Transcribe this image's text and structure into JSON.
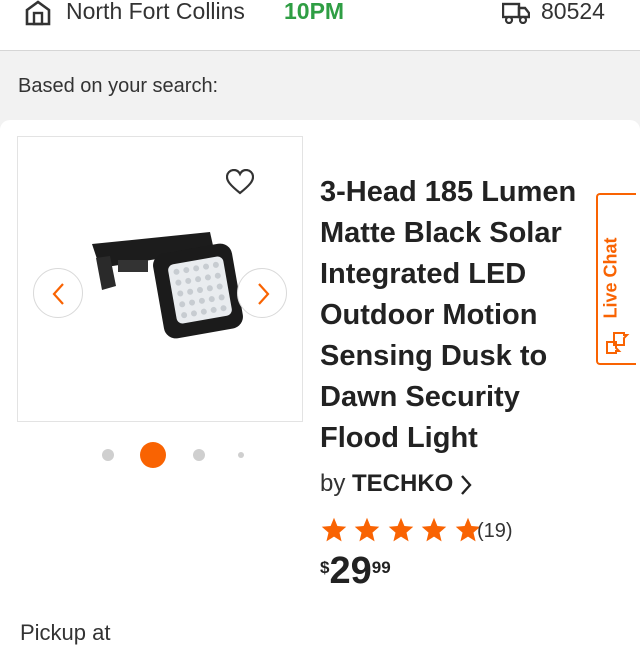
{
  "header": {
    "store_name": "North Fort Collins",
    "store_hours": "10PM",
    "zip": "80524",
    "store_icon": "store-icon",
    "delivery_icon": "truck-icon"
  },
  "search": {
    "label": "Based on your search:"
  },
  "product": {
    "title_lines": [
      "3-Head 185 Lumen",
      "Matte Black Solar",
      "Integrated LED",
      "Outdoor Motion",
      "Sensing Dusk to",
      "Dawn Security",
      "Flood Light"
    ],
    "by_label": "by",
    "brand": "TECHKO",
    "rating": 5,
    "review_count": "(19)",
    "price": {
      "currency": "$",
      "dollars": "29",
      "cents": "99"
    },
    "image_dots": {
      "count": 4,
      "active_index": 1
    }
  },
  "fulfillment": {
    "pickup_label": "Pickup at"
  },
  "live_chat": {
    "label": "Live Chat"
  },
  "colors": {
    "accent": "#f96302",
    "hours_green": "#2f9e44",
    "star": "#f96302"
  }
}
